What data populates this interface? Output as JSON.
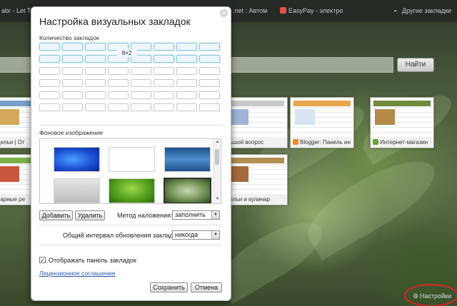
{
  "browser": {
    "bookmarks": [
      "abr - Let Th",
      ".net : Автом",
      "EasyPay - электро",
      "Другие закладки"
    ],
    "find_button": "Найти",
    "tiles": [
      {
        "caption": "дельи | От"
      },
      {
        "caption": "льшой вопрос"
      },
      {
        "caption": "Blogger: Панель ин"
      },
      {
        "caption": "Интернет-магазин"
      },
      {
        "caption": "нарные ре"
      },
      {
        "caption": "дельи и кулинар"
      }
    ],
    "settings_link": "Настройки"
  },
  "dialog": {
    "title": "Настройка визуальных закладок",
    "close_glyph": "×",
    "count_label": "Количество закладок",
    "grid_value": "8×2",
    "background_label": "Фоновое изображение",
    "add_button": "Добавить",
    "delete_button": "Удалить",
    "blend_label": "Метод наложения:",
    "blend_value": "заполнить",
    "refresh_label": "Общий интервал обновления закладок",
    "refresh_value": "никогда",
    "show_bar_label": "Отображать панель закладок",
    "show_bar_checked": true,
    "check_glyph": "✓",
    "license_link": "Лицензионное соглашение",
    "save_button": "Сохранить",
    "cancel_button": "Отмена",
    "dropdown_glyph": "▼",
    "scroll_up_glyph": "▲",
    "scroll_down_glyph": "▼"
  },
  "colors": {
    "accent": "#8cc8e0",
    "close_circle": "#d22222"
  }
}
